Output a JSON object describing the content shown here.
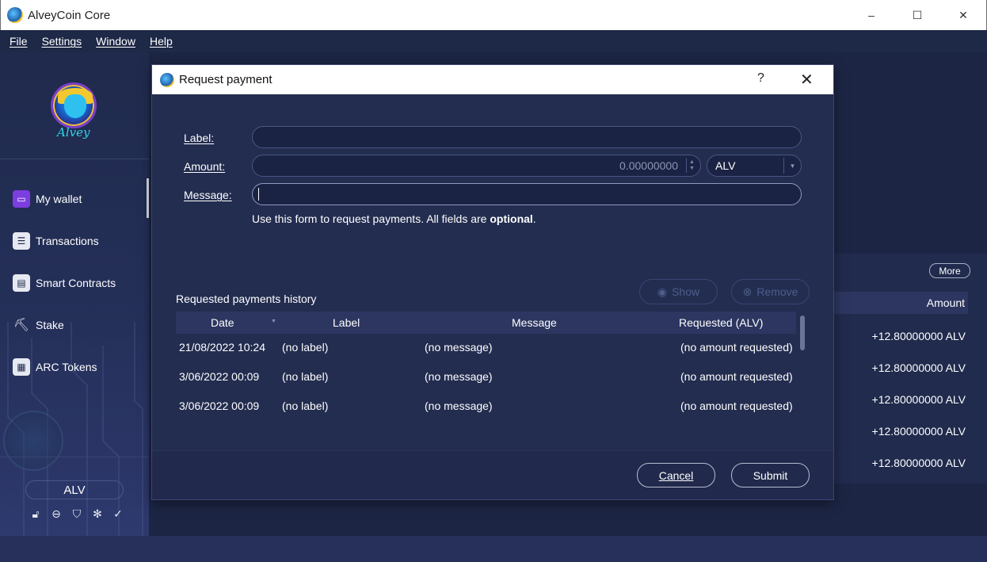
{
  "window": {
    "title": "AlveyCoin Core",
    "controls": [
      "–",
      "☐",
      "✕"
    ]
  },
  "menu": [
    {
      "label": "File"
    },
    {
      "label": "Settings"
    },
    {
      "label": "Window"
    },
    {
      "label": "Help"
    }
  ],
  "sidebar": {
    "logo_text": "Alvey",
    "items": [
      {
        "label": "My wallet",
        "icon": "wallet-icon",
        "active": true
      },
      {
        "label": "Transactions",
        "icon": "list-icon"
      },
      {
        "label": "Smart Contracts",
        "icon": "contract-icon"
      },
      {
        "label": "Stake",
        "icon": "stake-icon"
      },
      {
        "label": "ARC Tokens",
        "icon": "token-icon"
      }
    ],
    "unit": "ALV",
    "status_icons": [
      "lock-icon",
      "sync-icon",
      "staking-icon",
      "network-icon",
      "check-icon"
    ]
  },
  "background_panel": {
    "more_label": "More",
    "amount_header": "Amount",
    "amounts": [
      "+12.80000000 ALV",
      "+12.80000000 ALV",
      "+12.80000000 ALV",
      "+12.80000000 ALV",
      "+12.80000000 ALV"
    ]
  },
  "dialog": {
    "title": "Request payment",
    "help": "?",
    "close": "✕",
    "form": {
      "label_label": "Label:",
      "label_value": "",
      "amount_label": "Amount:",
      "amount_value": "0.00000000",
      "unit_value": "ALV",
      "message_label": "Message:",
      "message_value": "",
      "hint_prefix": "Use this form to request payments. All fields are ",
      "hint_bold": "optional",
      "hint_suffix": "."
    },
    "history": {
      "title": "Requested payments history",
      "show_label": "Show",
      "remove_label": "Remove",
      "columns": [
        "Date",
        "Label",
        "Message",
        "Requested (ALV)"
      ],
      "rows": [
        {
          "date": "21/08/2022 10:24",
          "label": "(no label)",
          "message": "(no message)",
          "requested": "(no amount requested)"
        },
        {
          "date": "3/06/2022 00:09",
          "label": "(no label)",
          "message": "(no message)",
          "requested": "(no amount requested)"
        },
        {
          "date": "3/06/2022 00:09",
          "label": "(no label)",
          "message": "(no message)",
          "requested": "(no amount requested)"
        }
      ]
    },
    "cancel_label": "Cancel",
    "submit_label": "Submit"
  }
}
